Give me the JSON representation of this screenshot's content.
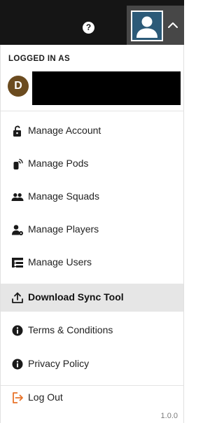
{
  "header": {
    "help_glyph": "?",
    "icons": {
      "help": "help-circle-icon",
      "avatar": "user-avatar-icon",
      "chevron": "chevron-up-icon"
    },
    "colors": {
      "topbar": "#151515",
      "account_area": "#474747",
      "avatar_bg": "#2c5a78"
    }
  },
  "account": {
    "logged_in_label": "LOGGED IN AS",
    "initial": "D",
    "initial_bg": "#6b4b1f",
    "name": "",
    "name_redacted": true
  },
  "menu": {
    "selected_index": 5,
    "items": [
      {
        "label": "Manage Account",
        "icon": "lock-icon"
      },
      {
        "label": "Manage Pods",
        "icon": "pod-sensor-icon"
      },
      {
        "label": "Manage Squads",
        "icon": "group-icon"
      },
      {
        "label": "Manage Players",
        "icon": "player-icon"
      },
      {
        "label": "Manage Users",
        "icon": "users-tree-icon"
      },
      {
        "label": "Download Sync Tool",
        "icon": "upload-icon"
      },
      {
        "label": "Terms & Conditions",
        "icon": "info-icon"
      },
      {
        "label": "Privacy Policy",
        "icon": "info-icon"
      }
    ],
    "logout": {
      "label": "Log Out",
      "icon": "logout-icon",
      "icon_color": "#e8732a"
    },
    "highlight_color": "#e6e6e6"
  },
  "footer": {
    "version": "1.0.0"
  }
}
